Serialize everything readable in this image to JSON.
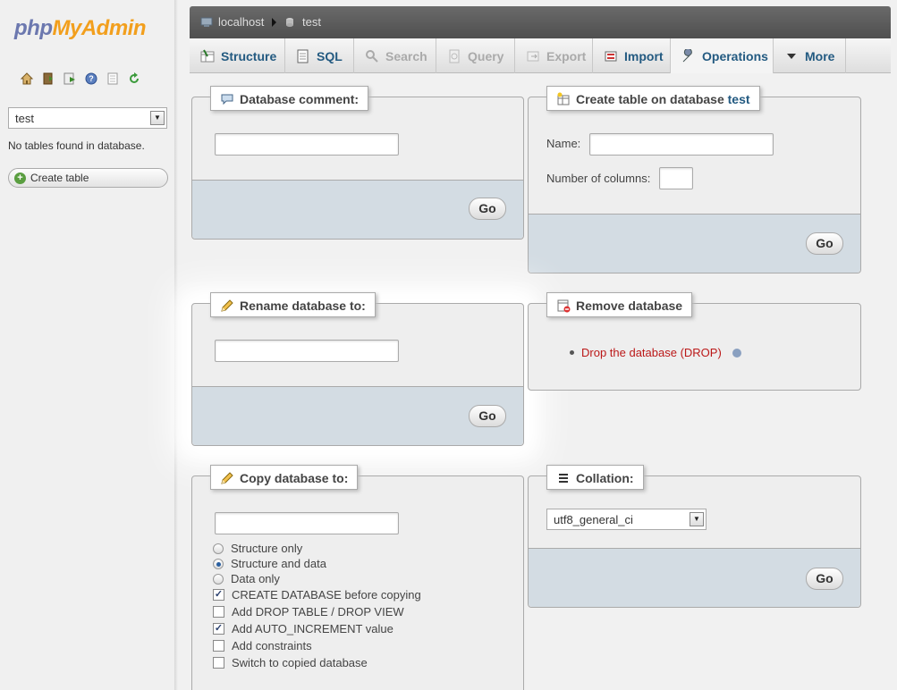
{
  "sidebar": {
    "logo_php": "php",
    "logo_my": "My",
    "logo_admin": "Admin",
    "nav_icons": [
      "home-icon",
      "exit-icon",
      "sql-query-icon",
      "docs-icon",
      "docs-wiki-icon",
      "reload-icon"
    ],
    "db_selected": "test",
    "no_tables": "No tables found in database.",
    "create_table": "Create table"
  },
  "breadcrumb": {
    "server": "localhost",
    "database": "test"
  },
  "tabs": [
    {
      "label": "Structure",
      "icon": "structure-icon",
      "state": "enabled"
    },
    {
      "label": "SQL",
      "icon": "sql-icon",
      "state": "enabled"
    },
    {
      "label": "Search",
      "icon": "search-icon",
      "state": "disabled"
    },
    {
      "label": "Query",
      "icon": "query-icon",
      "state": "disabled"
    },
    {
      "label": "Export",
      "icon": "export-icon",
      "state": "disabled"
    },
    {
      "label": "Import",
      "icon": "import-icon",
      "state": "enabled"
    },
    {
      "label": "Operations",
      "icon": "wrench-icon",
      "state": "active"
    },
    {
      "label": "More",
      "icon": "triangle-down-icon",
      "state": "enabled"
    }
  ],
  "db_comment": {
    "legend": "Database comment:",
    "value": "",
    "go": "Go"
  },
  "create_table": {
    "legend_prefix": "Create table on database",
    "legend_db": "test",
    "name_label": "Name:",
    "name_value": "",
    "columns_label": "Number of columns:",
    "columns_value": "",
    "go": "Go"
  },
  "rename_db": {
    "legend": "Rename database to:",
    "value": "",
    "go": "Go"
  },
  "remove_db": {
    "legend": "Remove database",
    "drop_link": "Drop the database (DROP)"
  },
  "copy_db": {
    "legend": "Copy database to:",
    "value": "",
    "radios": [
      {
        "label": "Structure only",
        "checked": false
      },
      {
        "label": "Structure and data",
        "checked": true
      },
      {
        "label": "Data only",
        "checked": false
      }
    ],
    "checkboxes": [
      {
        "label": "CREATE DATABASE before copying",
        "checked": true
      },
      {
        "label": "Add DROP TABLE / DROP VIEW",
        "checked": false
      },
      {
        "label": "Add AUTO_INCREMENT value",
        "checked": true
      },
      {
        "label": "Add constraints",
        "checked": false
      },
      {
        "label": "Switch to copied database",
        "checked": false
      }
    ]
  },
  "collation": {
    "legend": "Collation:",
    "selected": "utf8_general_ci",
    "go": "Go"
  }
}
